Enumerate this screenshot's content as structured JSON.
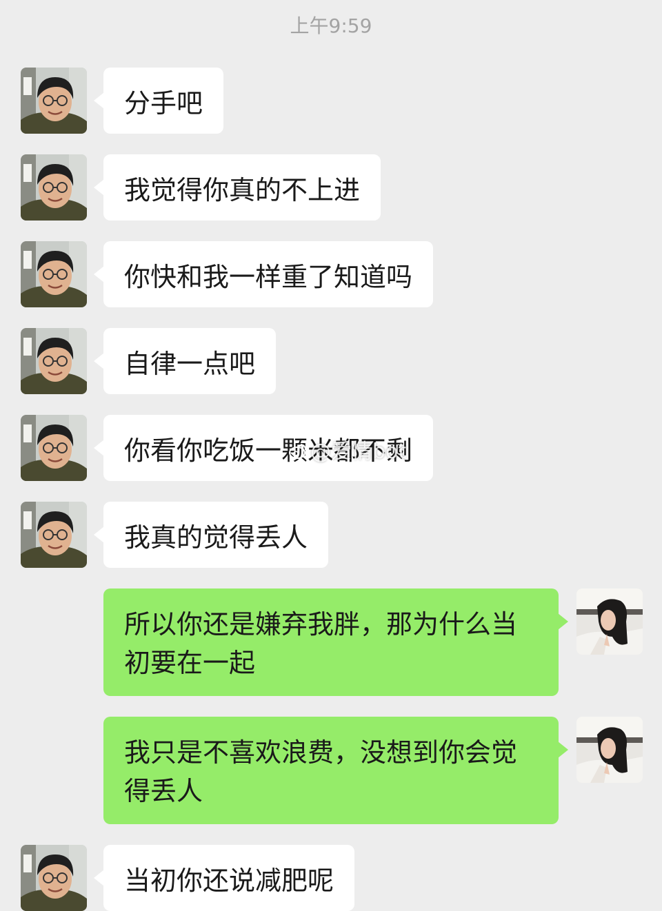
{
  "timestamp": "上午9:59",
  "messages": [
    {
      "sender": "other",
      "text": "分手吧"
    },
    {
      "sender": "other",
      "text": "我觉得你真的不上进"
    },
    {
      "sender": "other",
      "text": "你快和我一样重了知道吗"
    },
    {
      "sender": "other",
      "text": "自律一点吧"
    },
    {
      "sender": "other",
      "text": "你看你吃饭一颗米都不剩"
    },
    {
      "sender": "other",
      "text": "我真的觉得丢人"
    },
    {
      "sender": "self",
      "text": "所以你还是嫌弃我胖，那为什么当初要在一起"
    },
    {
      "sender": "self",
      "text": "我只是不喜欢浪费，没想到你会觉得丢人"
    },
    {
      "sender": "other",
      "text": "当初你还说减肥呢"
    }
  ],
  "watermark": {
    "text": "@爱情bot",
    "icon": "weibo-icon"
  },
  "colors": {
    "background": "#ededed",
    "bubble_other": "#ffffff",
    "bubble_self": "#95ec69",
    "timestamp_text": "#a3a3a3"
  }
}
